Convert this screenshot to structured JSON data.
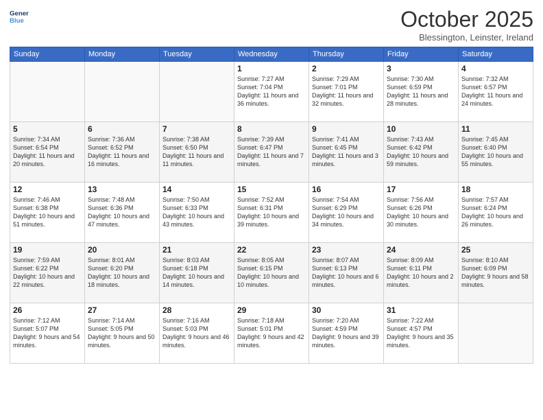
{
  "header": {
    "logo_line1": "General",
    "logo_line2": "Blue",
    "month": "October 2025",
    "location": "Blessington, Leinster, Ireland"
  },
  "weekdays": [
    "Sunday",
    "Monday",
    "Tuesday",
    "Wednesday",
    "Thursday",
    "Friday",
    "Saturday"
  ],
  "weeks": [
    [
      {
        "day": "",
        "sunrise": "",
        "sunset": "",
        "daylight": ""
      },
      {
        "day": "",
        "sunrise": "",
        "sunset": "",
        "daylight": ""
      },
      {
        "day": "",
        "sunrise": "",
        "sunset": "",
        "daylight": ""
      },
      {
        "day": "1",
        "sunrise": "Sunrise: 7:27 AM",
        "sunset": "Sunset: 7:04 PM",
        "daylight": "Daylight: 11 hours and 36 minutes."
      },
      {
        "day": "2",
        "sunrise": "Sunrise: 7:29 AM",
        "sunset": "Sunset: 7:01 PM",
        "daylight": "Daylight: 11 hours and 32 minutes."
      },
      {
        "day": "3",
        "sunrise": "Sunrise: 7:30 AM",
        "sunset": "Sunset: 6:59 PM",
        "daylight": "Daylight: 11 hours and 28 minutes."
      },
      {
        "day": "4",
        "sunrise": "Sunrise: 7:32 AM",
        "sunset": "Sunset: 6:57 PM",
        "daylight": "Daylight: 11 hours and 24 minutes."
      }
    ],
    [
      {
        "day": "5",
        "sunrise": "Sunrise: 7:34 AM",
        "sunset": "Sunset: 6:54 PM",
        "daylight": "Daylight: 11 hours and 20 minutes."
      },
      {
        "day": "6",
        "sunrise": "Sunrise: 7:36 AM",
        "sunset": "Sunset: 6:52 PM",
        "daylight": "Daylight: 11 hours and 16 minutes."
      },
      {
        "day": "7",
        "sunrise": "Sunrise: 7:38 AM",
        "sunset": "Sunset: 6:50 PM",
        "daylight": "Daylight: 11 hours and 11 minutes."
      },
      {
        "day": "8",
        "sunrise": "Sunrise: 7:39 AM",
        "sunset": "Sunset: 6:47 PM",
        "daylight": "Daylight: 11 hours and 7 minutes."
      },
      {
        "day": "9",
        "sunrise": "Sunrise: 7:41 AM",
        "sunset": "Sunset: 6:45 PM",
        "daylight": "Daylight: 11 hours and 3 minutes."
      },
      {
        "day": "10",
        "sunrise": "Sunrise: 7:43 AM",
        "sunset": "Sunset: 6:42 PM",
        "daylight": "Daylight: 10 hours and 59 minutes."
      },
      {
        "day": "11",
        "sunrise": "Sunrise: 7:45 AM",
        "sunset": "Sunset: 6:40 PM",
        "daylight": "Daylight: 10 hours and 55 minutes."
      }
    ],
    [
      {
        "day": "12",
        "sunrise": "Sunrise: 7:46 AM",
        "sunset": "Sunset: 6:38 PM",
        "daylight": "Daylight: 10 hours and 51 minutes."
      },
      {
        "day": "13",
        "sunrise": "Sunrise: 7:48 AM",
        "sunset": "Sunset: 6:36 PM",
        "daylight": "Daylight: 10 hours and 47 minutes."
      },
      {
        "day": "14",
        "sunrise": "Sunrise: 7:50 AM",
        "sunset": "Sunset: 6:33 PM",
        "daylight": "Daylight: 10 hours and 43 minutes."
      },
      {
        "day": "15",
        "sunrise": "Sunrise: 7:52 AM",
        "sunset": "Sunset: 6:31 PM",
        "daylight": "Daylight: 10 hours and 39 minutes."
      },
      {
        "day": "16",
        "sunrise": "Sunrise: 7:54 AM",
        "sunset": "Sunset: 6:29 PM",
        "daylight": "Daylight: 10 hours and 34 minutes."
      },
      {
        "day": "17",
        "sunrise": "Sunrise: 7:56 AM",
        "sunset": "Sunset: 6:26 PM",
        "daylight": "Daylight: 10 hours and 30 minutes."
      },
      {
        "day": "18",
        "sunrise": "Sunrise: 7:57 AM",
        "sunset": "Sunset: 6:24 PM",
        "daylight": "Daylight: 10 hours and 26 minutes."
      }
    ],
    [
      {
        "day": "19",
        "sunrise": "Sunrise: 7:59 AM",
        "sunset": "Sunset: 6:22 PM",
        "daylight": "Daylight: 10 hours and 22 minutes."
      },
      {
        "day": "20",
        "sunrise": "Sunrise: 8:01 AM",
        "sunset": "Sunset: 6:20 PM",
        "daylight": "Daylight: 10 hours and 18 minutes."
      },
      {
        "day": "21",
        "sunrise": "Sunrise: 8:03 AM",
        "sunset": "Sunset: 6:18 PM",
        "daylight": "Daylight: 10 hours and 14 minutes."
      },
      {
        "day": "22",
        "sunrise": "Sunrise: 8:05 AM",
        "sunset": "Sunset: 6:15 PM",
        "daylight": "Daylight: 10 hours and 10 minutes."
      },
      {
        "day": "23",
        "sunrise": "Sunrise: 8:07 AM",
        "sunset": "Sunset: 6:13 PM",
        "daylight": "Daylight: 10 hours and 6 minutes."
      },
      {
        "day": "24",
        "sunrise": "Sunrise: 8:09 AM",
        "sunset": "Sunset: 6:11 PM",
        "daylight": "Daylight: 10 hours and 2 minutes."
      },
      {
        "day": "25",
        "sunrise": "Sunrise: 8:10 AM",
        "sunset": "Sunset: 6:09 PM",
        "daylight": "Daylight: 9 hours and 58 minutes."
      }
    ],
    [
      {
        "day": "26",
        "sunrise": "Sunrise: 7:12 AM",
        "sunset": "Sunset: 5:07 PM",
        "daylight": "Daylight: 9 hours and 54 minutes."
      },
      {
        "day": "27",
        "sunrise": "Sunrise: 7:14 AM",
        "sunset": "Sunset: 5:05 PM",
        "daylight": "Daylight: 9 hours and 50 minutes."
      },
      {
        "day": "28",
        "sunrise": "Sunrise: 7:16 AM",
        "sunset": "Sunset: 5:03 PM",
        "daylight": "Daylight: 9 hours and 46 minutes."
      },
      {
        "day": "29",
        "sunrise": "Sunrise: 7:18 AM",
        "sunset": "Sunset: 5:01 PM",
        "daylight": "Daylight: 9 hours and 42 minutes."
      },
      {
        "day": "30",
        "sunrise": "Sunrise: 7:20 AM",
        "sunset": "Sunset: 4:59 PM",
        "daylight": "Daylight: 9 hours and 39 minutes."
      },
      {
        "day": "31",
        "sunrise": "Sunrise: 7:22 AM",
        "sunset": "Sunset: 4:57 PM",
        "daylight": "Daylight: 9 hours and 35 minutes."
      },
      {
        "day": "",
        "sunrise": "",
        "sunset": "",
        "daylight": ""
      }
    ]
  ]
}
